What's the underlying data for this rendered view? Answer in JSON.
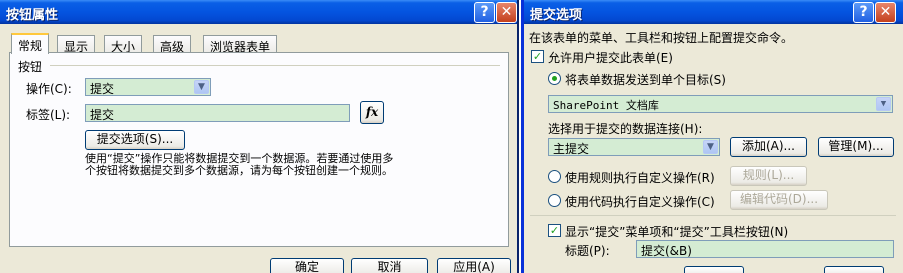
{
  "dialog1": {
    "title": "按钮属性",
    "help_glyph": "?",
    "close_glyph": "✕",
    "tabs": [
      "常规",
      "显示",
      "大小",
      "高级",
      "浏览器表单"
    ],
    "group_label": "按钮",
    "action_label": "操作(C):",
    "action_value": "提交",
    "tag_label": "标签(L):",
    "tag_value": "提交",
    "fx_label": "fx",
    "submit_options_button": "提交选项(S)...",
    "description": "使用“提交”操作只能将数据提交到一个数据源。若要通过使用多个按钮将数据提交到多个数据源，请为每个按钮创建一个规则。",
    "ok_button": "确定",
    "cancel_button": "取消",
    "apply_button": "应用(A)"
  },
  "dialog2": {
    "title": "提交选项",
    "help_glyph": "?",
    "close_glyph": "✕",
    "intro": "在该表单的菜单、工具栏和按钮上配置提交命令。",
    "allow_submit_label": "允许用户提交此表单(E)",
    "send_single_label": "将表单数据发送到单个目标(S)",
    "destination_value": "SharePoint 文档库",
    "connection_label": "选择用于提交的数据连接(H):",
    "connection_value": "主提交",
    "add_button": "添加(A)...",
    "manage_button": "管理(M)...",
    "rules_label": "使用规则执行自定义操作(R)",
    "rules_button": "规则(L)...",
    "code_label": "使用代码执行自定义操作(C)",
    "edit_code_button": "编辑代码(D)...",
    "show_menu_label": "显示“提交”菜单项和“提交”工具栏按钮(N)",
    "caption_label": "标题(P):",
    "caption_value": "提交(&B)"
  },
  "colors": {
    "titlebar": "#0454e0",
    "dialog_bg": "#ece9d8",
    "field_green": "#d4ecd3",
    "check_green": "#21a121"
  }
}
